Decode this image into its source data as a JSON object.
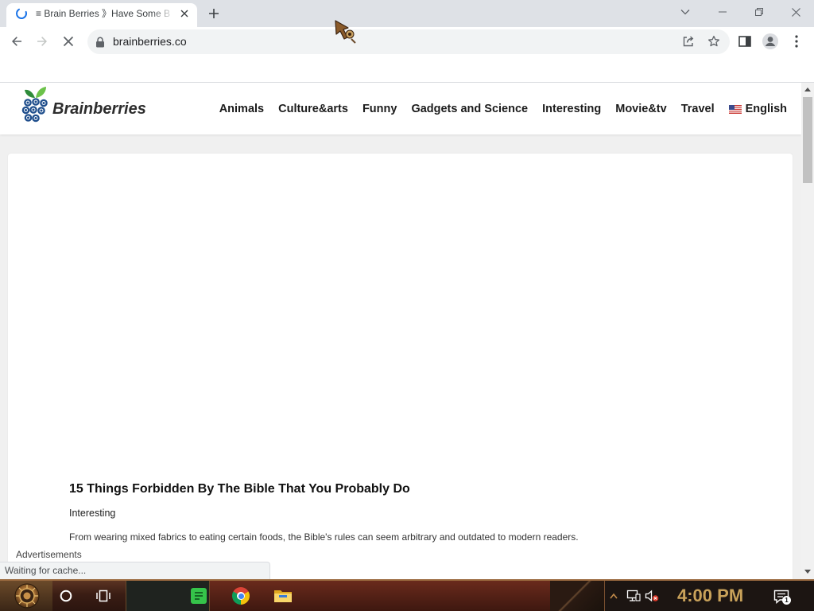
{
  "browser": {
    "tab": {
      "title": "≡ Brain Berries 》Have Some B"
    },
    "omnibox": {
      "url": "brainberries.co"
    },
    "status_bubble": {
      "text": "Waiting for cache..."
    }
  },
  "site": {
    "header": {
      "logo_text": "Brainberries",
      "nav": [
        {
          "label": "Animals"
        },
        {
          "label": "Culture&arts"
        },
        {
          "label": "Funny"
        },
        {
          "label": "Gadgets and Science"
        },
        {
          "label": "Interesting"
        },
        {
          "label": "Movie&tv"
        },
        {
          "label": "Travel"
        }
      ],
      "language": {
        "label": "English",
        "flag_icon": "us-flag-icon"
      }
    },
    "main": {
      "article": {
        "title": "15 Things Forbidden By The Bible That You Probably Do",
        "category": "Interesting",
        "excerpt": "From wearing mixed fabrics to eating certain foods, the Bible's rules can seem arbitrary and outdated to modern readers."
      },
      "ads_label": "Advertisements"
    }
  },
  "taskbar": {
    "clock": "4:00 PM",
    "notification_count": "1"
  },
  "icons": {
    "tab": [
      "loading-spinner-icon",
      "tab-close-icon",
      "new-tab-icon"
    ],
    "window": [
      "tab-search-icon",
      "minimize-icon",
      "restore-icon",
      "window-close-icon"
    ],
    "toolbar": [
      "back-arrow-icon",
      "forward-arrow-icon",
      "stop-loading-icon",
      "lock-icon",
      "share-icon",
      "bookmark-star-icon",
      "side-panel-icon",
      "profile-icon",
      "menu-dots-icon"
    ],
    "page": [
      "brainberries-logo-icon",
      "us-flag-icon"
    ],
    "taskbar": [
      "start-button-icon",
      "cortana-icon",
      "task-view-icon",
      "sticky-notes-icon",
      "chrome-icon",
      "file-explorer-icon",
      "show-hidden-icons-icon",
      "network-icon",
      "volume-muted-icon",
      "notification-center-icon"
    ]
  },
  "colors": {
    "accent": "#1a73e8",
    "tab_strip": "#dee1e6",
    "omnibox": "#f1f3f4",
    "page_background": "#f0f0f0",
    "berry_blue": "#1f4e8c",
    "leaf_green": "#4caf3a",
    "taskbar_frame": "#5a3322",
    "clock_gold": "#c9a25a"
  }
}
